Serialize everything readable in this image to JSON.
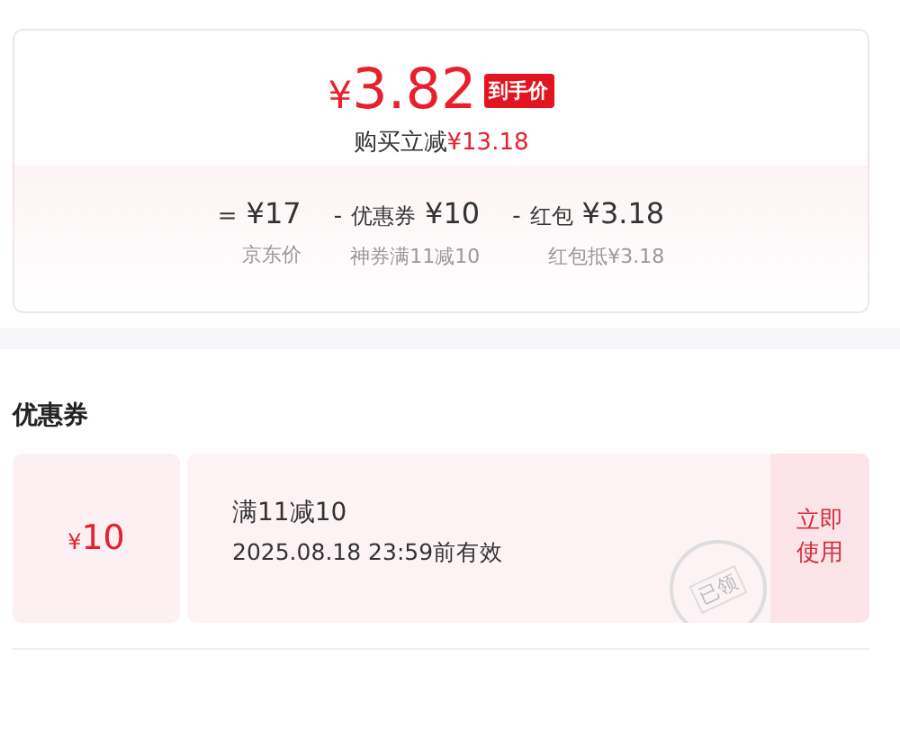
{
  "price_card": {
    "final_price": {
      "currency": "¥",
      "amount": "3.82"
    },
    "badge": "到手价",
    "saving": {
      "label": "购买立减",
      "amount": "¥13.18"
    },
    "breakdown": [
      {
        "sign": "=",
        "amount": "¥17",
        "note": "京东价"
      },
      {
        "sign": "-",
        "name": "优惠券",
        "amount": "¥10",
        "note": "神券满11减10"
      },
      {
        "sign": "-",
        "name": "红包",
        "amount": "¥3.18",
        "note": "红包抵¥3.18"
      }
    ]
  },
  "coupons": {
    "title": "优惠券",
    "items": [
      {
        "currency": "¥",
        "amount": "10",
        "condition": "满11减10",
        "validity": "2025.08.18 23:59前有效",
        "stamp": "已领",
        "action": "立即使用"
      }
    ]
  }
}
